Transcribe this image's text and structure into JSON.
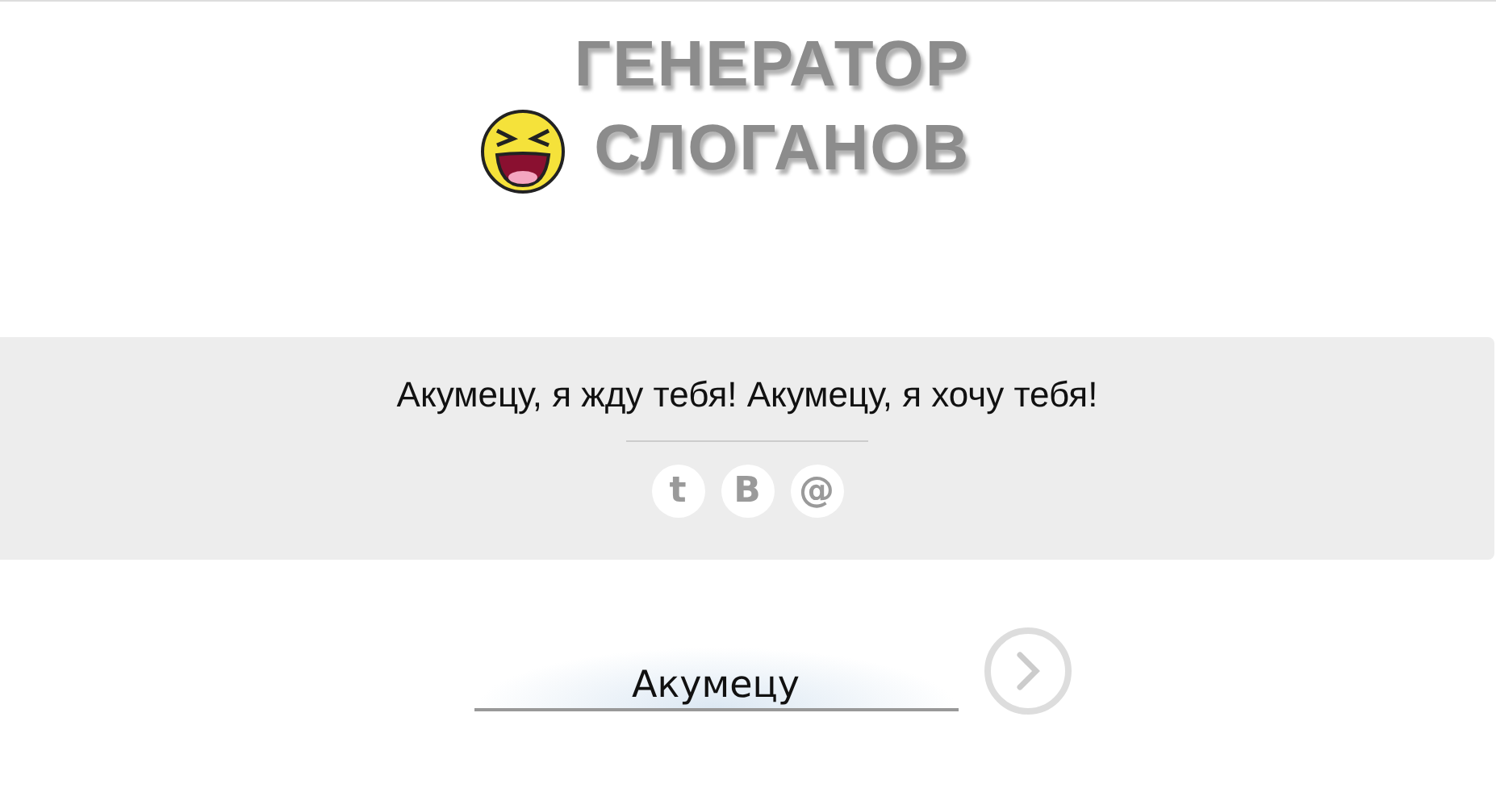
{
  "logo": {
    "lines": [
      "ГЕНЕРАТОР",
      "СЛОГАНОВ"
    ]
  },
  "slogan": {
    "text": "Акумецу, я жду тебя! Акумецу, я хочу тебя!"
  },
  "share_buttons": [
    {
      "label": "t"
    },
    {
      "label": "В"
    },
    {
      "label": "@"
    }
  ],
  "name_field": {
    "value": "Акумецу"
  }
}
